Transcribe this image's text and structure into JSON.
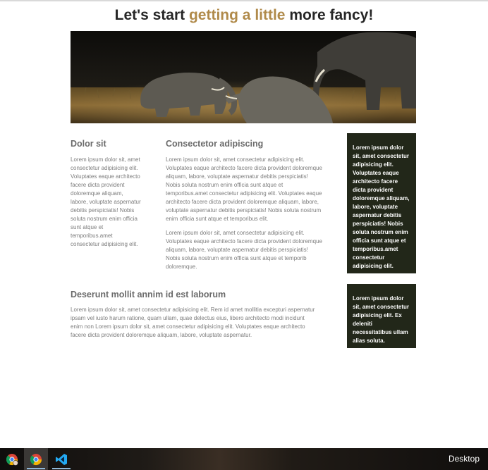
{
  "header": {
    "title_start": "Let's start ",
    "title_accent": "getting a little",
    "title_end": " more fancy!",
    "accent_color": "#b08a4a"
  },
  "hero": {
    "image": "elephants-photo"
  },
  "left_column": {
    "heading": "Dolor sit",
    "text": "Lorem ipsum dolor sit, amet consectetur adipisicing elit. Voluptates eaque architecto facere dicta provident doloremque aliquam, labore, voluptate aspernatur debitis perspiciatis! Nobis soluta nostrum enim officia sunt atque et temporibus.amet consectetur adipisicing elit."
  },
  "middle_column": {
    "heading": "Consectetor adipiscing",
    "paragraph_1": "Lorem ipsum dolor sit, amet consectetur adipisicing elit. Voluptates eaque architecto facere dicta provident doloremque aliquam, labore, voluptate aspernatur debitis perspiciatis! Nobis soluta nostrum enim officia sunt atque et temporibus.amet consectetur adipisicing elit. Voluptates eaque architecto facere dicta provident doloremque aliquam, labore, voluptate aspernatur debitis perspiciatis! Nobis soluta nostrum enim officia sunt atque et temporibus elit.",
    "paragraph_2": "Lorem ipsum dolor sit, amet consectetur adipisicing elit. Voluptates eaque architecto facere dicta provident doloremque aliquam, labore, voluptate aspernatur debitis perspiciatis! Nobis soluta nostrum enim officia sunt atque et temporib doloremque."
  },
  "sidebar": {
    "box_1": "Lorem ipsum dolor sit, amet consectetur adipisicing elit. Voluptates eaque architecto facere dicta provident doloremque aliquam, labore, voluptate aspernatur debitis perspiciatis! Nobis soluta nostrum enim officia sunt atque et temporibus.amet consectetur adipisicing elit.",
    "box_2": "Lorem ipsum dolor sit, amet consectetur adipisicing elit. Ex deleniti necessitatibus ullam alias soluta.",
    "box_color": "#222719"
  },
  "wide_section": {
    "heading": "Deserunt mollit annim id est laborum",
    "text": "Lorem ipsum dolor sit, amet consectetur adipisicing elit. Rem id amet mollitia excepturi aspernatur ipsam vel iusto harum ratione, quam ullam, quae delectus eius, libero architecto modi incidunt enim non Lorem ipsum dolor sit, amet consectetur adipisicing elit. Voluptates eaque architecto facere dicta provident doloremque aliquam, labore, voluptate aspernatur."
  },
  "taskbar": {
    "icons": [
      "chrome-profile-icon",
      "chrome-icon",
      "vscode-icon"
    ],
    "desktop_label": "Desktop"
  }
}
